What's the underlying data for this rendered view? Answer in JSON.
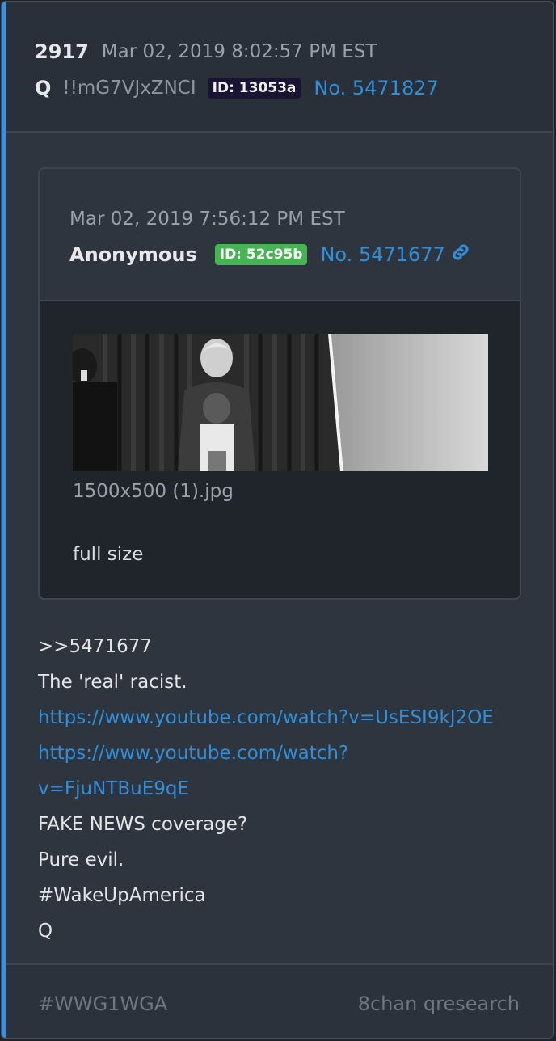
{
  "post": {
    "number": "2917",
    "timestamp": "Mar 02, 2019 8:02:57 PM EST",
    "author": "Q",
    "tripcode": "!!mG7VJxZNCI",
    "id_badge": "ID: 13053a",
    "post_no": "No. 5471827"
  },
  "quoted": {
    "timestamp": "Mar 02, 2019 7:56:12 PM EST",
    "author": "Anonymous",
    "id_badge": "ID: 52c95b",
    "post_no": "No. 5471677",
    "link_icon": "link-icon",
    "image_filename": "1500x500 (1).jpg",
    "full_size_label": "full size"
  },
  "message": {
    "reply_ref": ">>5471677",
    "line1": "The 'real' racist.",
    "link1": "https://www.youtube.com/watch?v=UsESI9kJ2OE",
    "link2_a": "https://www.youtube.com/watch?",
    "link2_b": "v=FjuNTBuE9qE",
    "line2": "FAKE NEWS coverage?",
    "line3": "Pure evil.",
    "line4": "#WakeUpAmerica",
    "signature": "Q"
  },
  "footer": {
    "hashtag": "#WWG1WGA",
    "source": "8chan qresearch"
  },
  "colors": {
    "accent": "#3f8fe0",
    "link": "#2f8fd8",
    "id_green": "#45b551",
    "id_dark": "#1a1433"
  }
}
